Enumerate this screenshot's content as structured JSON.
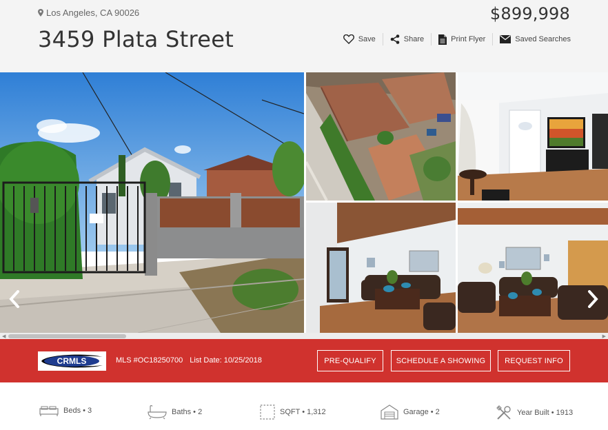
{
  "header": {
    "location": "Los Angeles, CA 90026",
    "title": "3459 Plata Street",
    "price": "$899,998",
    "actions": [
      {
        "label": "Save",
        "icon": "heart-icon"
      },
      {
        "label": "Share",
        "icon": "share-icon"
      },
      {
        "label": "Print Flyer",
        "icon": "document-icon"
      },
      {
        "label": "Saved Searches",
        "icon": "envelope-icon"
      }
    ]
  },
  "gallery": {
    "photos": [
      "exterior-front-gate",
      "aerial-rooftop",
      "living-room-tv",
      "living-room-sofas",
      "living-room-coffee-table"
    ],
    "prev_icon": "chevron-left-icon",
    "next_icon": "chevron-right-icon"
  },
  "listing_bar": {
    "logo_text": "CRMLS",
    "mls": "MLS #OC18250700",
    "list_date": "List Date: 10/25/2018",
    "buttons": {
      "prequalify": "PRE-QUALIFY",
      "schedule": "SCHEDULE A SHOWING",
      "request": "REQUEST INFO"
    },
    "color": "#d0322e"
  },
  "features": {
    "beds": "Beds • 3",
    "baths": "Baths • 2",
    "sqft": "SQFT • 1,312",
    "garage": "Garage • 2",
    "year": "Year Built • 1913"
  }
}
